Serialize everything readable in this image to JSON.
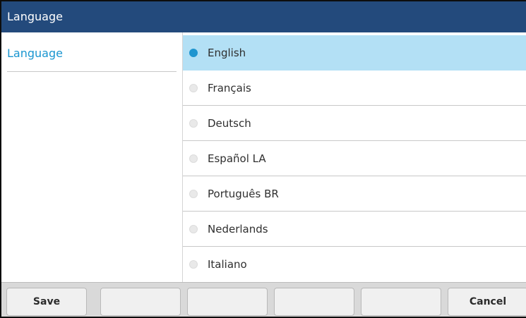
{
  "title": "Language",
  "sidebar": {
    "items": [
      {
        "label": "Language"
      }
    ]
  },
  "options": [
    {
      "label": "English",
      "selected": true
    },
    {
      "label": "Français",
      "selected": false
    },
    {
      "label": "Deutsch",
      "selected": false
    },
    {
      "label": "Español LA",
      "selected": false
    },
    {
      "label": "Português BR",
      "selected": false
    },
    {
      "label": "Nederlands",
      "selected": false
    },
    {
      "label": "Italiano",
      "selected": false
    }
  ],
  "softkeys": [
    {
      "label": "Save"
    },
    {
      "label": ""
    },
    {
      "label": ""
    },
    {
      "label": ""
    },
    {
      "label": ""
    },
    {
      "label": "Cancel"
    }
  ],
  "colors": {
    "title_bar": "#234a7c",
    "accent": "#1a96d0",
    "selected_row": "#b3e0f5",
    "softkey_bar": "#d9d9d9"
  }
}
